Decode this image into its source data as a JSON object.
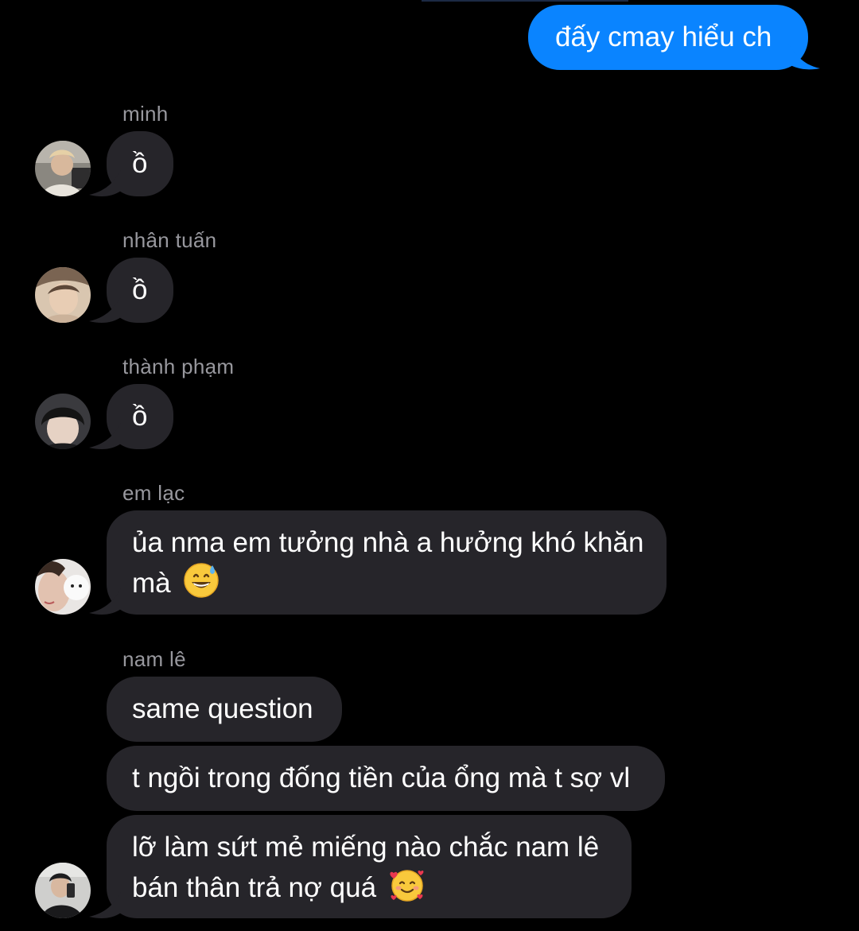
{
  "chat": {
    "outgoing": {
      "text": "đấy cmay hiểu ch"
    },
    "groups": [
      {
        "sender": "minh",
        "messages": [
          "ồ"
        ],
        "avatar_icon": "avatar-minh-photo"
      },
      {
        "sender": "nhân tuấn",
        "messages": [
          "ồ"
        ],
        "avatar_icon": "avatar-nhan-tuan-photo"
      },
      {
        "sender": "thành phạm",
        "messages": [
          "ồ"
        ],
        "avatar_icon": "avatar-thanh-pham-photo"
      },
      {
        "sender": "em lạc",
        "messages": [
          {
            "line1": "ủa nma em tưởng nhà a hưởng khó khăn",
            "line2": "mà",
            "emoji": "grinning-face-with-sweat"
          }
        ],
        "avatar_icon": "avatar-em-lac-photo"
      },
      {
        "sender": "nam lê",
        "messages": [
          "same question",
          "t ngồi trong đống tiền của ổng mà t sợ vl",
          {
            "line1": "lỡ làm sứt mẻ miếng nào chắc nam lê",
            "line2": "bán thân trả nợ quá",
            "emoji": "smiling-face-with-hearts"
          }
        ],
        "avatar_icon": "avatar-nam-le-photo"
      }
    ]
  },
  "colors": {
    "background": "#000000",
    "incoming_bubble": "#26252a",
    "outgoing_bubble": "#0a84ff",
    "sender_name": "#98989e",
    "text": "#ffffff"
  }
}
